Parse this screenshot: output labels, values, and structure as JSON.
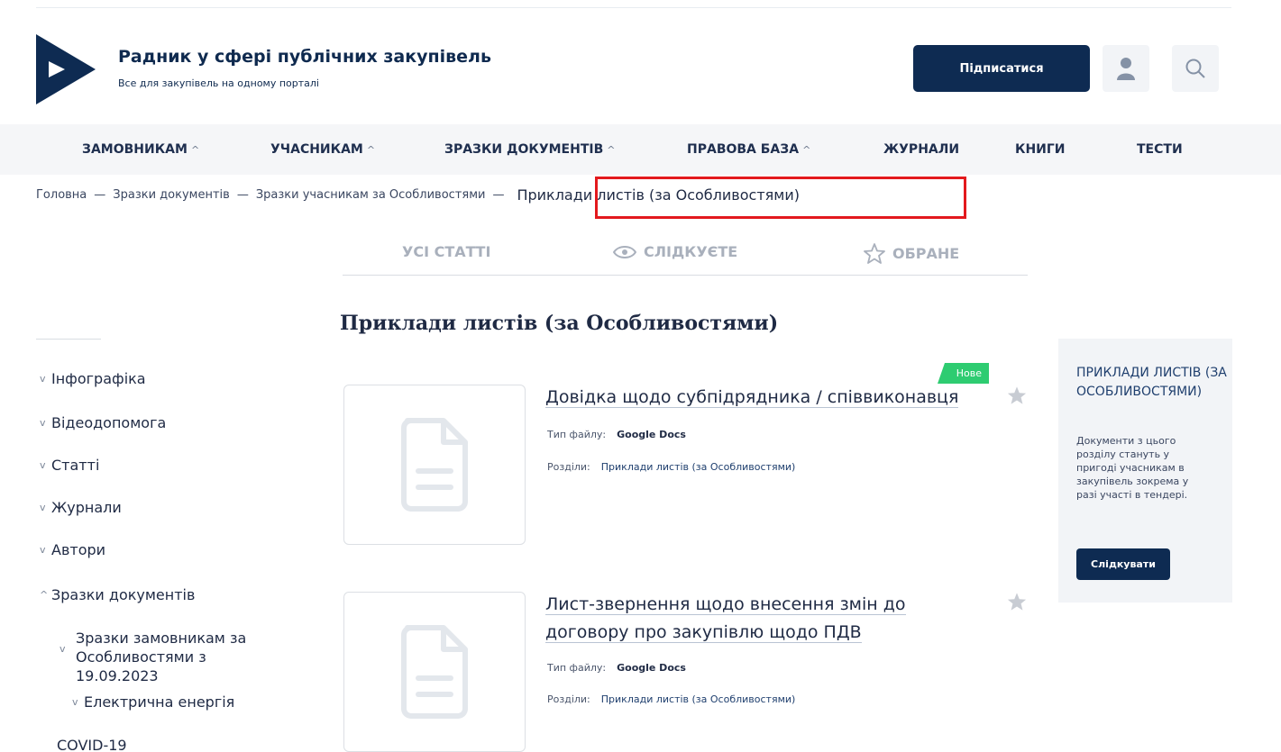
{
  "header": {
    "site_title": "Радник у сфері публічних закупівель",
    "site_subtitle": "Все для закупівель на одному порталі",
    "subscribe_label": "Підписатися",
    "brand_color": "#0e2b52"
  },
  "nav": {
    "items": [
      {
        "label": "ЗАМОВНИКАМ",
        "has_dropdown": true
      },
      {
        "label": "УЧАСНИКАМ",
        "has_dropdown": true
      },
      {
        "label": "ЗРАЗКИ ДОКУМЕНТІВ",
        "has_dropdown": true
      },
      {
        "label": "ПРАВОВА БАЗА",
        "has_dropdown": true
      },
      {
        "label": "ЖУРНАЛИ",
        "has_dropdown": false
      },
      {
        "label": "КНИГИ",
        "has_dropdown": false
      },
      {
        "label": "ТЕСТИ",
        "has_dropdown": false
      }
    ]
  },
  "breadcrumb": {
    "items": [
      "Головна",
      "Зразки документів",
      "Зразки учасникам за Особливостями"
    ],
    "current": "Приклади листів (за Особливостями)",
    "separator": "—",
    "highlight_color": "#e3191d"
  },
  "tabs": [
    {
      "label": "УСІ СТАТТІ",
      "icon": ""
    },
    {
      "label": "СЛІДКУЄТЕ",
      "icon": "eye-icon"
    },
    {
      "label": "ОБРАНЕ",
      "icon": "star-outline-icon"
    }
  ],
  "page": {
    "heading": "Приклади листів (за Особливостями)"
  },
  "sidebar": {
    "items": [
      {
        "label": "Інфографіка",
        "expanded": false
      },
      {
        "label": "Відеодопомога",
        "expanded": false
      },
      {
        "label": "Статті",
        "expanded": false
      },
      {
        "label": "Журнали",
        "expanded": false
      },
      {
        "label": "Автори",
        "expanded": false
      },
      {
        "label": "Зразки документів",
        "expanded": true
      }
    ],
    "subitems": [
      {
        "label": "Зразки замовникам за Особливостями з 19.09.2023"
      },
      {
        "label": "Електрична енергія"
      }
    ],
    "last_item": "COVID-19"
  },
  "documents": [
    {
      "title": "Довідка щодо субпідрядника / співвиконавця",
      "badge": "Нове",
      "file_type_label": "Тип файлу:",
      "file_type": "Google Docs",
      "sections_label": "Розділи:",
      "sections": "Приклади листів (за Особливостями)"
    },
    {
      "title": "Лист-звернення щодо внесення змін до договору про закупівлю щодо ПДВ",
      "badge": "",
      "file_type_label": "Тип файлу:",
      "file_type": "Google Docs",
      "sections_label": "Розділи:",
      "sections": "Приклади листів (за Особливостями)"
    }
  ],
  "panel": {
    "title": "ПРИКЛАДИ ЛИСТІВ (ЗА ОСОБЛИВОСТЯМИ)",
    "text": "Документи з цього розділу стануть у пригоді учасникам в закупівель зокрема у разі участі в тендері.",
    "button_label": "Слідкувати"
  },
  "colors": {
    "badge_green": "#2ecc71",
    "star_gray": "#c8ccd3"
  }
}
